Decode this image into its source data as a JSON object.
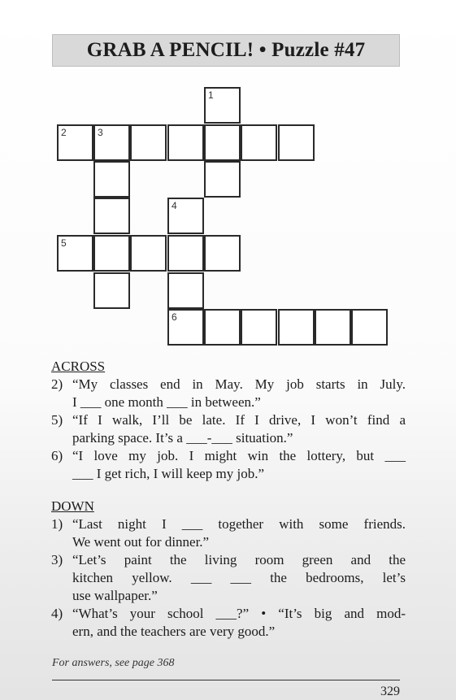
{
  "header": {
    "title": "GRAB A PENCIL! • Puzzle #47"
  },
  "grid_numbers": [
    "1",
    "2",
    "3",
    "4",
    "5",
    "6"
  ],
  "across": {
    "heading": "ACROSS",
    "clues": [
      {
        "num": "2)",
        "lines": [
          "“My classes end in May. My job starts in July.",
          "I ___ one month ___ in between.”"
        ]
      },
      {
        "num": "5)",
        "lines": [
          "“If I walk, I’ll be late. If I drive, I won’t find a",
          "parking space. It’s a ___-___ situation.”"
        ]
      },
      {
        "num": "6)",
        "lines": [
          "“I love my job. I might win the lottery, but ___",
          "___ I get rich, I will keep my job.”"
        ]
      }
    ]
  },
  "down": {
    "heading": "DOWN",
    "clues": [
      {
        "num": "1)",
        "lines": [
          "“Last night I ___ together with some friends.",
          "We went out for dinner.”"
        ]
      },
      {
        "num": "3)",
        "lines": [
          "“Let’s paint the living room green and the",
          "kitchen yellow. ___ ___ the bedrooms, let’s",
          "use wallpaper.”"
        ]
      },
      {
        "num": "4)",
        "lines": [
          "“What’s your school ___?” • “It’s big and mod-",
          "ern, and the teachers are very good.”"
        ]
      }
    ]
  },
  "footer": {
    "note": "For answers, see page 368",
    "page_number": "329"
  }
}
